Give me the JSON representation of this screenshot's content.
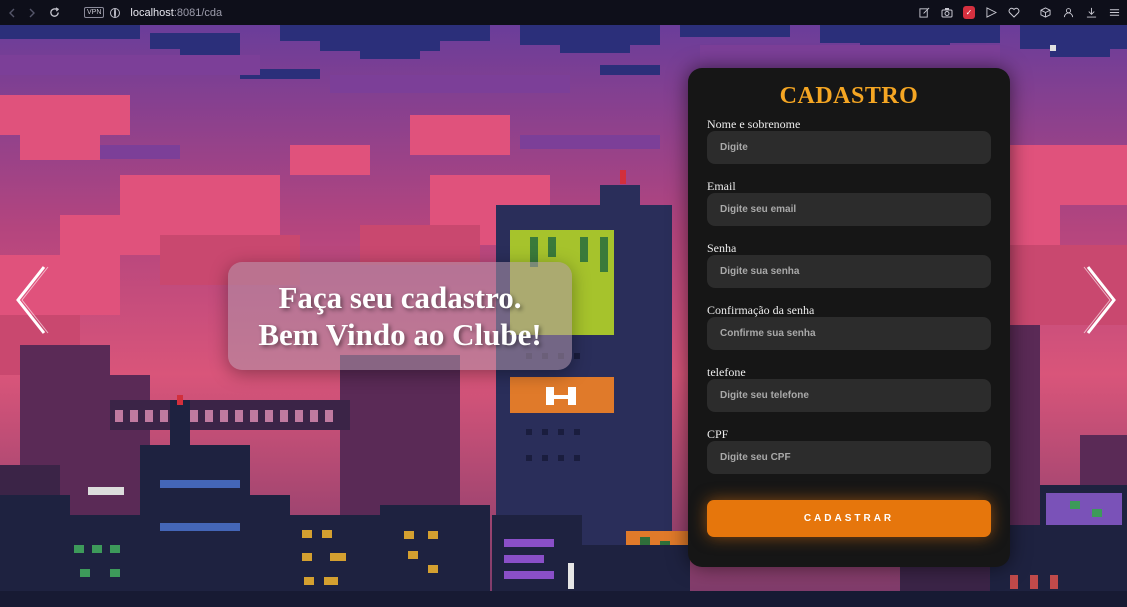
{
  "browser": {
    "url_host": "localhost",
    "url_path": ":8081/cda",
    "vpn_label": "VPN"
  },
  "hero": {
    "line1": "Faça seu cadastro.",
    "line2": "Bem Vindo ao Clube!"
  },
  "form": {
    "title": "CADASTRO",
    "fields": [
      {
        "label": "Nome e sobrenome",
        "placeholder": "Digite"
      },
      {
        "label": "Email",
        "placeholder": "Digite seu email"
      },
      {
        "label": "Senha",
        "placeholder": "Digite sua senha"
      },
      {
        "label": "Confirmação da senha",
        "placeholder": "Confirme sua senha"
      },
      {
        "label": "telefone",
        "placeholder": "Digite seu telefone"
      },
      {
        "label": "CPF",
        "placeholder": "Digite seu CPF"
      }
    ],
    "submit_label": "CADASTRAR"
  },
  "colors": {
    "accent": "#e6760c",
    "title": "#f5a623",
    "card": "#161616",
    "input": "#2c2c2c"
  },
  "icons": {
    "back": "arrow-left-icon",
    "forward": "arrow-right-icon",
    "reload": "reload-icon",
    "prev_slide": "chevron-left-icon",
    "next_slide": "chevron-right-icon"
  }
}
